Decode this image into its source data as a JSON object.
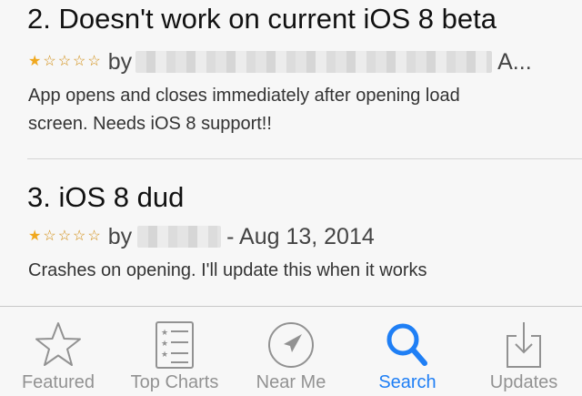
{
  "reviews": [
    {
      "title": "2. Doesn't work on current iOS 8 beta",
      "rating": 1,
      "by_label": "by",
      "author_suffix": "A...",
      "body_line1": "App opens and closes immediately after opening load",
      "body_line2": "screen. Needs iOS 8 support!!"
    },
    {
      "title": "3. iOS 8 dud",
      "rating": 1,
      "by_label": "by",
      "date": "- Aug 13, 2014",
      "body_line1": "Crashes on opening. I'll update this when it works"
    }
  ],
  "tabbar": {
    "tabs": [
      {
        "label": "Featured",
        "icon": "star-icon"
      },
      {
        "label": "Top Charts",
        "icon": "list-icon"
      },
      {
        "label": "Near Me",
        "icon": "location-arrow-icon"
      },
      {
        "label": "Search",
        "icon": "search-icon",
        "active": true
      },
      {
        "label": "Updates",
        "icon": "download-tray-icon"
      }
    ],
    "active_color": "#1f7ff5",
    "inactive_color": "#929292"
  },
  "colors": {
    "star": "#f0a81e"
  }
}
